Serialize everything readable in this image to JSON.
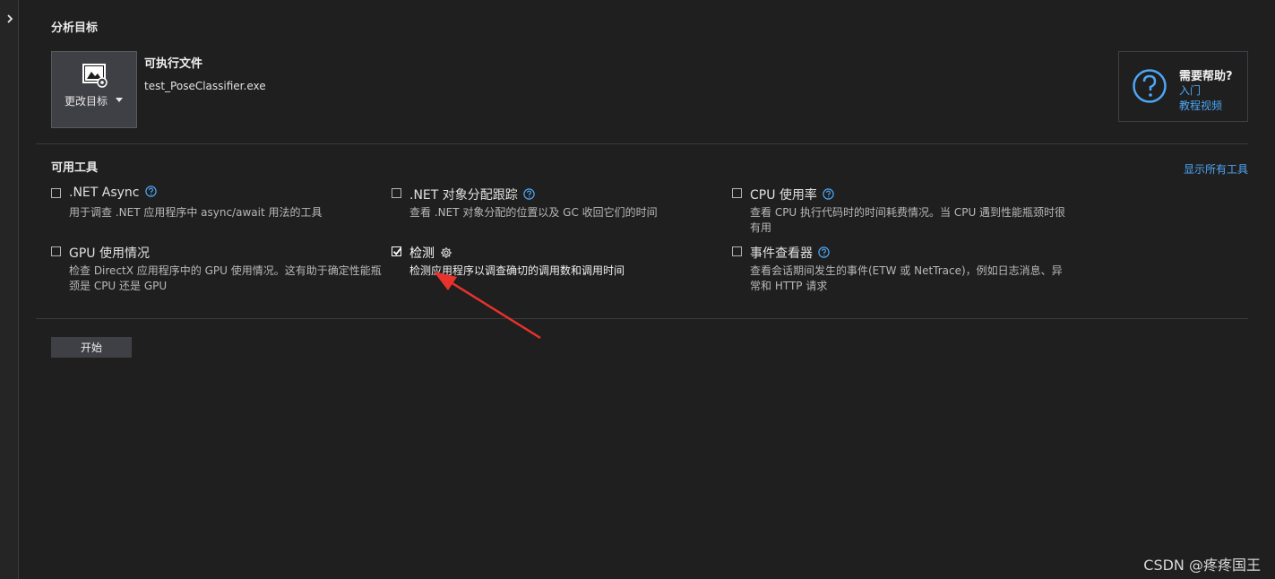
{
  "target_section": {
    "title": "分析目标",
    "change_target_label": "更改目标",
    "executable_title": "可执行文件",
    "executable_name": "test_PoseClassifier.exe"
  },
  "help": {
    "title": "需要帮助?",
    "links": [
      "入门",
      "教程视频"
    ],
    "accent_color": "#4ea6f5"
  },
  "tools_section": {
    "title": "可用工具",
    "show_all_label": "显示所有工具",
    "tools": [
      {
        "name": ".NET Async",
        "description": "用于调查 .NET 应用程序中 async/await 用法的工具",
        "checked": false,
        "icon": "help-icon"
      },
      {
        "name": ".NET 对象分配跟踪",
        "description": "查看 .NET 对象分配的位置以及 GC 收回它们的时间",
        "checked": false,
        "icon": "help-icon"
      },
      {
        "name": "CPU 使用率",
        "description": "查看 CPU 执行代码时的时间耗费情况。当 CPU 遇到性能瓶颈时很有用",
        "checked": false,
        "icon": "help-icon"
      },
      {
        "name": "GPU 使用情况",
        "description": "检查 DirectX 应用程序中的 GPU 使用情况。这有助于确定性能瓶颈是 CPU 还是 GPU",
        "checked": false,
        "icon": null
      },
      {
        "name": "检测",
        "description": "检测应用程序以调查确切的调用数和调用时间",
        "checked": true,
        "icon": "gear-icon"
      },
      {
        "name": "事件查看器",
        "description": "查看会话期间发生的事件(ETW 或 NetTrace)，例如日志消息、异常和 HTTP 请求",
        "checked": false,
        "icon": "help-icon"
      }
    ]
  },
  "start_button_label": "开始",
  "watermark": "CSDN @疼疼国王",
  "annotation_arrow_color": "#e8322c"
}
